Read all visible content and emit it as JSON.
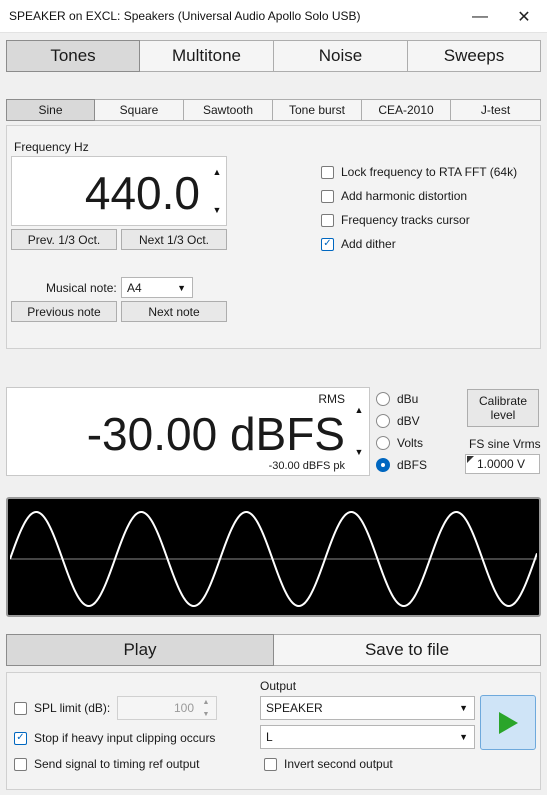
{
  "window": {
    "title": "SPEAKER on EXCL: Speakers (Universal Audio Apollo Solo USB)",
    "minimize_glyph": "—",
    "close_glyph": "✕"
  },
  "main_tabs": [
    "Tones",
    "Multitone",
    "Noise",
    "Sweeps"
  ],
  "main_tab_active": "Tones",
  "sub_tabs": [
    "Sine",
    "Square",
    "Sawtooth",
    "Tone burst",
    "CEA-2010",
    "J-test"
  ],
  "sub_tab_active": "Sine",
  "frequency": {
    "label": "Frequency Hz",
    "value": "440.0",
    "prev_label": "Prev. 1/3 Oct.",
    "next_label": "Next 1/3 Oct."
  },
  "options": [
    {
      "label": "Lock frequency to RTA FFT (64k)",
      "checked": false
    },
    {
      "label": "Add harmonic distortion",
      "checked": false
    },
    {
      "label": "Frequency tracks cursor",
      "checked": false
    },
    {
      "label": "Add dither",
      "checked": true
    }
  ],
  "note": {
    "label": "Musical note:",
    "value": "A4",
    "prev_label": "Previous note",
    "next_label": "Next note"
  },
  "level": {
    "mode": "RMS",
    "value": "-30.00 dBFS",
    "peak": "-30.00 dBFS pk",
    "units": [
      {
        "label": "dBu",
        "selected": false
      },
      {
        "label": "dBV",
        "selected": false
      },
      {
        "label": "Volts",
        "selected": false
      },
      {
        "label": "dBFS",
        "selected": true
      }
    ],
    "calibrate_label": "Calibrate level",
    "fs_label": "FS sine Vrms",
    "fs_value": "1.0000 V"
  },
  "waveform": {
    "cycles": 5,
    "background": "#000000",
    "trace_color": "#ffffff"
  },
  "actions": {
    "play_label": "Play",
    "save_label": "Save to file",
    "active": "Play"
  },
  "bottom": {
    "spl_label": "SPL limit (dB):",
    "spl_checked": false,
    "spl_value": "100",
    "stop_label": "Stop if heavy input clipping occurs",
    "stop_checked": true,
    "send_label": "Send signal to timing ref output",
    "send_checked": false,
    "output_label": "Output",
    "output_value": "SPEAKER",
    "channel_value": "L",
    "invert_label": "Invert second output",
    "invert_checked": false,
    "play_color": "#2aa52a"
  }
}
